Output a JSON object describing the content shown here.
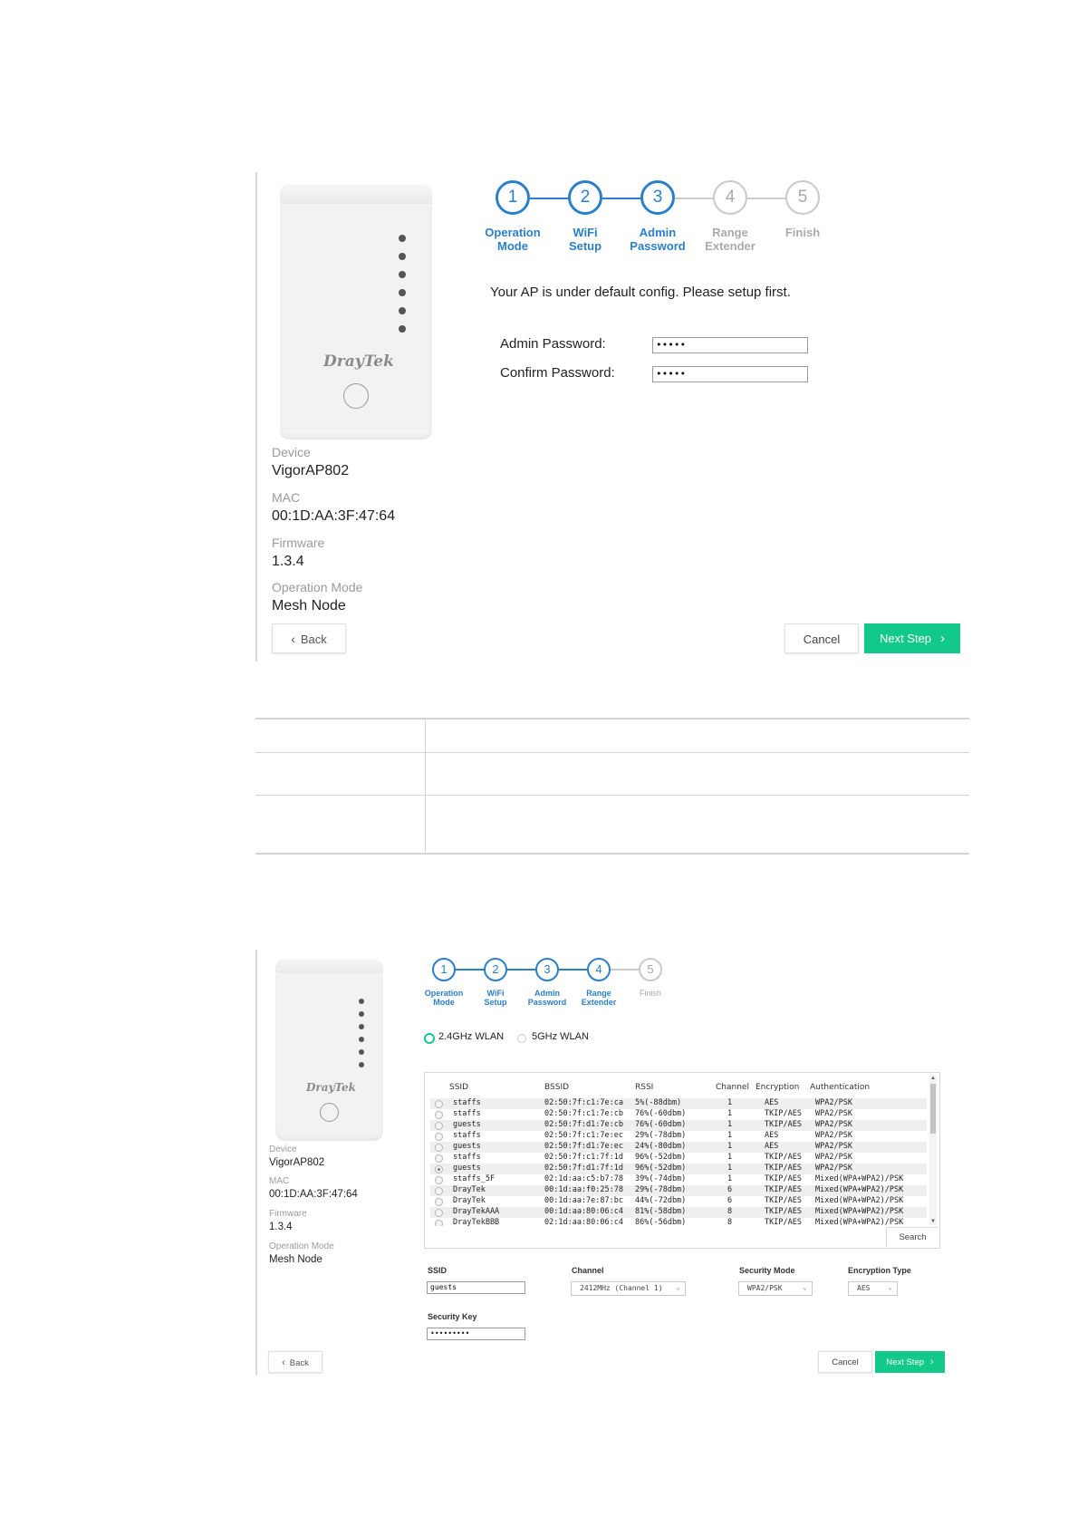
{
  "screen1": {
    "steps": [
      {
        "num": "1",
        "label1": "Operation",
        "label2": "Mode",
        "active": true
      },
      {
        "num": "2",
        "label1": "WiFi",
        "label2": "Setup",
        "active": true
      },
      {
        "num": "3",
        "label1": "Admin",
        "label2": "Password",
        "active": true
      },
      {
        "num": "4",
        "label1": "Range",
        "label2": "Extender",
        "active": false
      },
      {
        "num": "5",
        "label1": "Finish",
        "label2": "",
        "active": false
      }
    ],
    "notice": "Your AP is under default config. Please setup first.",
    "admin_password_label": "Admin Password:",
    "admin_password_value": "•••••",
    "confirm_password_label": "Confirm Password:",
    "confirm_password_value": "•••••",
    "device_brand": "DrayTek",
    "info": {
      "device_label": "Device",
      "device_value": "VigorAP802",
      "mac_label": "MAC",
      "mac_value": "00:1D:AA:3F:47:64",
      "firmware_label": "Firmware",
      "firmware_value": "1.3.4",
      "mode_label": "Operation Mode",
      "mode_value": "Mesh Node"
    },
    "back_label": "Back",
    "cancel_label": "Cancel",
    "next_label": "Next Step"
  },
  "screen2": {
    "steps": [
      {
        "num": "1",
        "label1": "Operation",
        "label2": "Mode",
        "active": true
      },
      {
        "num": "2",
        "label1": "WiFi",
        "label2": "Setup",
        "active": true
      },
      {
        "num": "3",
        "label1": "Admin",
        "label2": "Password",
        "active": true
      },
      {
        "num": "4",
        "label1": "Range",
        "label2": "Extender",
        "active": true
      },
      {
        "num": "5",
        "label1": "Finish",
        "label2": "",
        "active": false
      }
    ],
    "band_24": "2.4GHz WLAN",
    "band_5": "5GHz WLAN",
    "device_brand": "DrayTek",
    "headers": {
      "ssid": "SSID",
      "bssid": "BSSID",
      "rssi": "RSSI",
      "channel": "Channel",
      "encryption": "Encryption",
      "auth": "Authentication"
    },
    "rows": [
      {
        "ssid": "staffs",
        "bssid": "02:50:7f:c1:7e:ca",
        "rssi": "5%(-88dbm)",
        "channel": "1",
        "enc": "AES",
        "auth": "WPA2/PSK",
        "selected": false
      },
      {
        "ssid": "staffs",
        "bssid": "02:50:7f:c1:7e:cb",
        "rssi": "76%(-60dbm)",
        "channel": "1",
        "enc": "TKIP/AES",
        "auth": "WPA2/PSK",
        "selected": false
      },
      {
        "ssid": "guests",
        "bssid": "02:50:7f:d1:7e:cb",
        "rssi": "76%(-60dbm)",
        "channel": "1",
        "enc": "TKIP/AES",
        "auth": "WPA2/PSK",
        "selected": false
      },
      {
        "ssid": "staffs",
        "bssid": "02:50:7f:c1:7e:ec",
        "rssi": "29%(-78dbm)",
        "channel": "1",
        "enc": "AES",
        "auth": "WPA2/PSK",
        "selected": false
      },
      {
        "ssid": "guests",
        "bssid": "02:50:7f:d1:7e:ec",
        "rssi": "24%(-80dbm)",
        "channel": "1",
        "enc": "AES",
        "auth": "WPA2/PSK",
        "selected": false
      },
      {
        "ssid": "staffs",
        "bssid": "02:50:7f:c1:7f:1d",
        "rssi": "96%(-52dbm)",
        "channel": "1",
        "enc": "TKIP/AES",
        "auth": "WPA2/PSK",
        "selected": false
      },
      {
        "ssid": "guests",
        "bssid": "02:50:7f:d1:7f:1d",
        "rssi": "96%(-52dbm)",
        "channel": "1",
        "enc": "TKIP/AES",
        "auth": "WPA2/PSK",
        "selected": true
      },
      {
        "ssid": "staffs_5F",
        "bssid": "02:1d:aa:c5:b7:78",
        "rssi": "39%(-74dbm)",
        "channel": "1",
        "enc": "TKIP/AES",
        "auth": "Mixed(WPA+WPA2)/PSK",
        "selected": false
      },
      {
        "ssid": "DrayTek",
        "bssid": "00:1d:aa:f0:25:78",
        "rssi": "29%(-78dbm)",
        "channel": "6",
        "enc": "TKIP/AES",
        "auth": "Mixed(WPA+WPA2)/PSK",
        "selected": false
      },
      {
        "ssid": "DrayTek",
        "bssid": "00:1d:aa:7e:87:bc",
        "rssi": "44%(-72dbm)",
        "channel": "6",
        "enc": "TKIP/AES",
        "auth": "Mixed(WPA+WPA2)/PSK",
        "selected": false
      },
      {
        "ssid": "DrayTekAAA",
        "bssid": "00:1d:aa:80:06:c4",
        "rssi": "81%(-58dbm)",
        "channel": "8",
        "enc": "TKIP/AES",
        "auth": "Mixed(WPA+WPA2)/PSK",
        "selected": false
      },
      {
        "ssid": "DrayTekBBB",
        "bssid": "02:1d:aa:80:06:c4",
        "rssi": "86%(-56dbm)",
        "channel": "8",
        "enc": "TKIP/AES",
        "auth": "Mixed(WPA+WPA2)/PSK",
        "selected": false
      }
    ],
    "search_label": "Search",
    "ssid_label": "SSID",
    "ssid_value": "guests",
    "channel_label": "Channel",
    "channel_value": "2412MHz (Channel 1)",
    "security_mode_label": "Security Mode",
    "security_mode_value": "WPA2/PSK",
    "encryption_type_label": "Encryption Type",
    "encryption_type_value": "AES",
    "security_key_label": "Security Key",
    "security_key_value": "•••••••••",
    "info": {
      "device_label": "Device",
      "device_value": "VigorAP802",
      "mac_label": "MAC",
      "mac_value": "00:1D:AA:3F:47:64",
      "firmware_label": "Firmware",
      "firmware_value": "1.3.4",
      "mode_label": "Operation Mode",
      "mode_value": "Mesh Node"
    },
    "back_label": "Back",
    "cancel_label": "Cancel",
    "next_label": "Next Step"
  },
  "colors": {
    "accent": "#2a7fc8",
    "next_button": "#12c98a",
    "inactive": "#aaaaaa"
  }
}
